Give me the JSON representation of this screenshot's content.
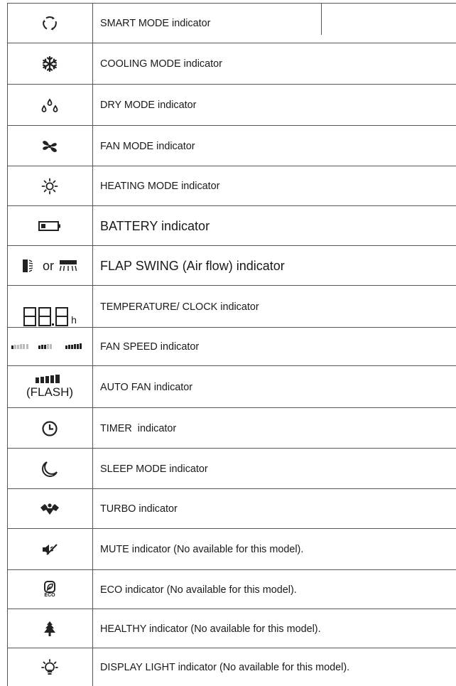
{
  "rows": [
    {
      "icon": "smart-mode-icon",
      "label": "SMART MODE indicator"
    },
    {
      "icon": "cooling-mode-icon",
      "label": "COOLING MODE indicator"
    },
    {
      "icon": "dry-mode-icon",
      "label": "DRY MODE indicator"
    },
    {
      "icon": "fan-mode-icon",
      "label": "FAN MODE indicator"
    },
    {
      "icon": "heating-mode-icon",
      "label": "HEATING MODE indicator"
    },
    {
      "icon": "battery-icon",
      "label": "BATTERY indicator"
    },
    {
      "icon": "flap-swing-icon",
      "label": "FLAP SWING (Air flow) indicator",
      "icon_text": "or"
    },
    {
      "icon": "temperature-clock-icon",
      "label": "TEMPERATURE/ CLOCK indicator",
      "icon_text": "h"
    },
    {
      "icon": "fan-speed-icon",
      "label": "FAN SPEED indicator"
    },
    {
      "icon": "auto-fan-icon",
      "label": "AUTO FAN indicator",
      "icon_text": "(FLASH)"
    },
    {
      "icon": "timer-icon",
      "label": "TIMER  indicator"
    },
    {
      "icon": "sleep-mode-icon",
      "label": "SLEEP MODE indicator"
    },
    {
      "icon": "turbo-icon",
      "label": "TURBO indicator"
    },
    {
      "icon": "mute-icon",
      "label": "MUTE indicator (No available for this model)."
    },
    {
      "icon": "eco-icon",
      "label": "ECO indicator (No available for this model).",
      "icon_text": "ECO"
    },
    {
      "icon": "healthy-icon",
      "label": "HEALTHY indicator (No available for this model)."
    },
    {
      "icon": "display-light-icon",
      "label": "DISPLAY LIGHT indicator (No available for this model)."
    }
  ]
}
